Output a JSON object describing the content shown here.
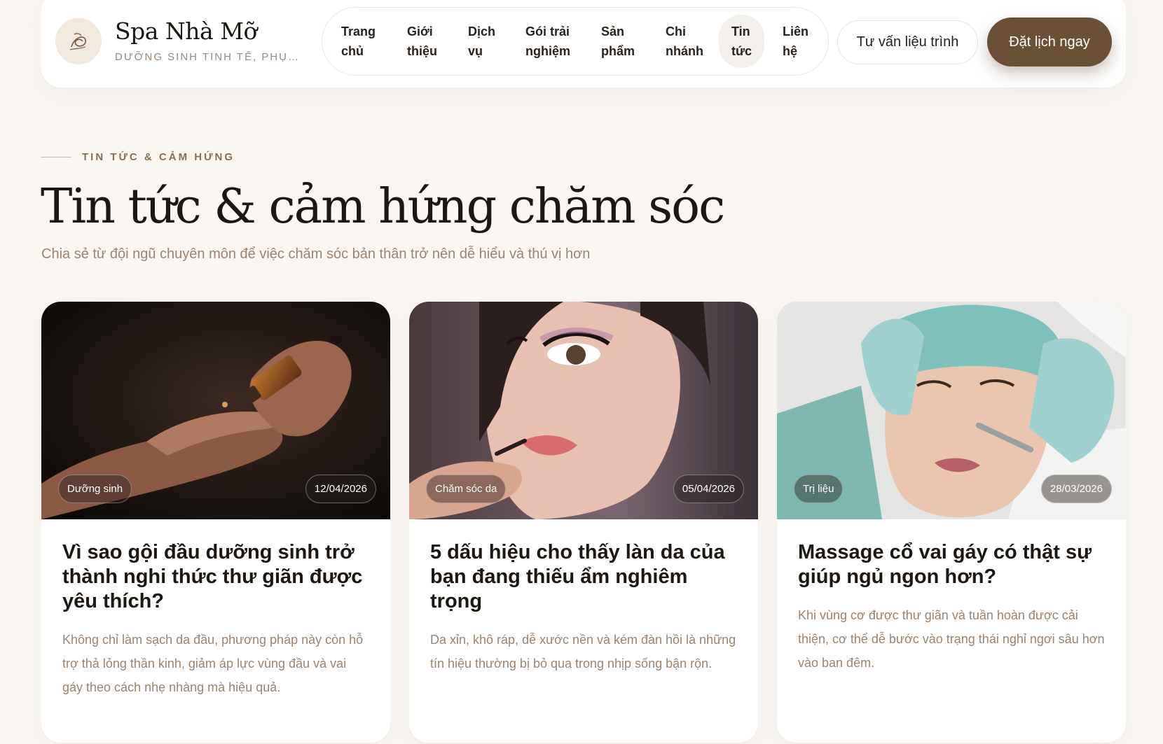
{
  "header": {
    "brand_name": "Spa Nhà Mỡ",
    "brand_tagline": "DƯỠNG SINH TINH TẾ, PHỤC HỒI",
    "nav": [
      {
        "line1": "Trang",
        "line2": "chủ"
      },
      {
        "line1": "Giới",
        "line2": "thiệu"
      },
      {
        "line1": "Dịch",
        "line2": "vụ"
      },
      {
        "line1": "Gói trải",
        "line2": "nghiệm"
      },
      {
        "line1": "Sản",
        "line2": "phẩm"
      },
      {
        "line1": "Chi",
        "line2": "nhánh"
      },
      {
        "line1": "Tin",
        "line2": "tức"
      },
      {
        "line1": "Liên",
        "line2": "hệ"
      }
    ],
    "consult_label": "Tư vấn liệu trình",
    "book_label": "Đặt lịch ngay"
  },
  "section": {
    "eyebrow": "TIN TỨC & CẢM HỨNG",
    "title": "Tin tức & cảm hứng chăm sóc",
    "subtitle": "Chia sẻ từ đội ngũ chuyên môn để việc chăm sóc bản thân trở nên dễ hiểu và thú vị hơn"
  },
  "articles": [
    {
      "category": "Dưỡng sinh",
      "date": "12/04/2026",
      "title": "Vì sao gội đầu dưỡng sinh trở thành nghi thức thư giãn được yêu thích?",
      "excerpt": "Không chỉ làm sạch da đầu, phương pháp này còn hỗ trợ thả lỏng thần kinh, giảm áp lực vùng đầu và vai gáy theo cách nhẹ nhàng mà hiệu quả."
    },
    {
      "category": "Chăm sóc da",
      "date": "05/04/2026",
      "title": "5 dấu hiệu cho thấy làn da của bạn đang thiếu ẩm nghiêm trọng",
      "excerpt": "Da xỉn, khô ráp, dễ xước nền và kém đàn hồi là những tín hiệu thường bị bỏ qua trong nhịp sống bận rộn."
    },
    {
      "category": "Trị liệu",
      "date": "28/03/2026",
      "title": "Massage cổ vai gáy có thật sự giúp ngủ ngon hơn?",
      "excerpt": "Khi vùng cơ được thư giãn và tuần hoàn được cải thiện, cơ thể dễ bước vào trạng thái nghỉ ngơi sâu hơn vào ban đêm."
    }
  ],
  "colors": {
    "background": "#faf7f3",
    "brand_brown": "#6b5038",
    "muted_text": "#9a8471"
  }
}
